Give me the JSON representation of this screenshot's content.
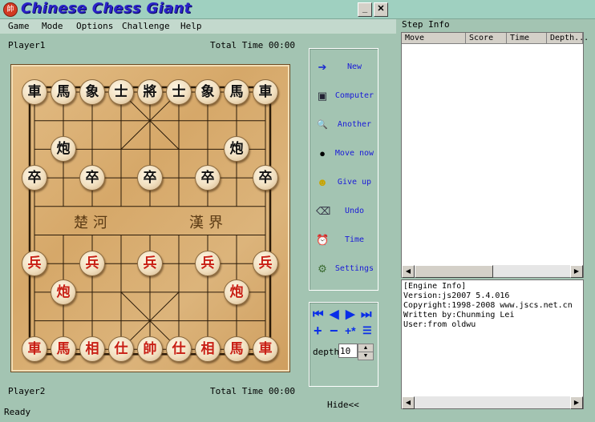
{
  "window": {
    "title": "Chinese Chess Giant",
    "app_icon_glyph": "帥",
    "minimize_label": "_",
    "close_label": "✕"
  },
  "menu": [
    "Game",
    "Mode",
    "Options",
    "Challenge",
    "Help"
  ],
  "players": {
    "top_name": "Player1",
    "top_time": "Total Time 00:00",
    "bottom_name": "Player2",
    "bottom_time": "Total Time 00:00"
  },
  "board": {
    "river_left": "楚河",
    "river_right": "漢界",
    "pieces": [
      {
        "char": "車",
        "side": "black",
        "col": 0,
        "row": 0
      },
      {
        "char": "馬",
        "side": "black",
        "col": 1,
        "row": 0
      },
      {
        "char": "象",
        "side": "black",
        "col": 2,
        "row": 0
      },
      {
        "char": "士",
        "side": "black",
        "col": 3,
        "row": 0
      },
      {
        "char": "將",
        "side": "black",
        "col": 4,
        "row": 0
      },
      {
        "char": "士",
        "side": "black",
        "col": 5,
        "row": 0
      },
      {
        "char": "象",
        "side": "black",
        "col": 6,
        "row": 0
      },
      {
        "char": "馬",
        "side": "black",
        "col": 7,
        "row": 0
      },
      {
        "char": "車",
        "side": "black",
        "col": 8,
        "row": 0
      },
      {
        "char": "炮",
        "side": "black",
        "col": 1,
        "row": 2
      },
      {
        "char": "炮",
        "side": "black",
        "col": 7,
        "row": 2
      },
      {
        "char": "卒",
        "side": "black",
        "col": 0,
        "row": 3
      },
      {
        "char": "卒",
        "side": "black",
        "col": 2,
        "row": 3
      },
      {
        "char": "卒",
        "side": "black",
        "col": 4,
        "row": 3
      },
      {
        "char": "卒",
        "side": "black",
        "col": 6,
        "row": 3
      },
      {
        "char": "卒",
        "side": "black",
        "col": 8,
        "row": 3
      },
      {
        "char": "兵",
        "side": "red",
        "col": 0,
        "row": 6
      },
      {
        "char": "兵",
        "side": "red",
        "col": 2,
        "row": 6
      },
      {
        "char": "兵",
        "side": "red",
        "col": 4,
        "row": 6
      },
      {
        "char": "兵",
        "side": "red",
        "col": 6,
        "row": 6
      },
      {
        "char": "兵",
        "side": "red",
        "col": 8,
        "row": 6
      },
      {
        "char": "炮",
        "side": "red",
        "col": 1,
        "row": 7
      },
      {
        "char": "炮",
        "side": "red",
        "col": 7,
        "row": 7
      },
      {
        "char": "車",
        "side": "red",
        "col": 0,
        "row": 9
      },
      {
        "char": "馬",
        "side": "red",
        "col": 1,
        "row": 9
      },
      {
        "char": "相",
        "side": "red",
        "col": 2,
        "row": 9
      },
      {
        "char": "仕",
        "side": "red",
        "col": 3,
        "row": 9
      },
      {
        "char": "帥",
        "side": "red",
        "col": 4,
        "row": 9
      },
      {
        "char": "仕",
        "side": "red",
        "col": 5,
        "row": 9
      },
      {
        "char": "相",
        "side": "red",
        "col": 6,
        "row": 9
      },
      {
        "char": "馬",
        "side": "red",
        "col": 7,
        "row": 9
      },
      {
        "char": "車",
        "side": "red",
        "col": 8,
        "row": 9
      }
    ]
  },
  "controls": {
    "new": {
      "label": "New",
      "icon": "➔"
    },
    "computer": {
      "label": "Computer",
      "icon": "▣"
    },
    "another": {
      "label": "Another",
      "icon": "🔍"
    },
    "move_now": {
      "label": "Move now",
      "icon": "●"
    },
    "give_up": {
      "label": "Give up",
      "icon": "☻"
    },
    "undo": {
      "label": "Undo",
      "icon": "⌫"
    },
    "time": {
      "label": "Time",
      "icon": "⏰"
    },
    "settings": {
      "label": "Settings",
      "icon": "⚙"
    }
  },
  "nav": {
    "first": "⏮",
    "prev": "◀",
    "next": "▶",
    "last": "⏭",
    "plus": "+",
    "minus": "−",
    "plus_star": "+*",
    "list": "☰",
    "depth_label": "depth",
    "depth_value": "10",
    "hide_label": "Hide<<"
  },
  "step_info": {
    "label": "Step Info",
    "columns": [
      "Move",
      "Score",
      "Time",
      "Depth..."
    ]
  },
  "engine_info": [
    "[Engine Info]",
    "Version:js2007 5.4.016",
    "Copyright:1998-2008 www.jscs.net.cn",
    "Written by:Chunming Lei",
    "User:from oldwu"
  ],
  "status": {
    "text": "Ready"
  }
}
